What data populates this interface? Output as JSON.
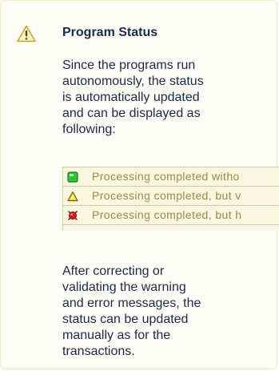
{
  "callout": {
    "type": "warning",
    "title": "Program Status",
    "intro": "Since the programs run autonomously, the status is automatically updated and can be displayed as following:",
    "outro": "After correcting or validating the warning and error messages, the status can be updated manually as for the transactions."
  },
  "status_table": {
    "rows": [
      {
        "icon": "green-square-status-icon",
        "label": "Processing completed witho"
      },
      {
        "icon": "yellow-triangle-warning-icon",
        "label": "Processing completed, but v"
      },
      {
        "icon": "red-error-status-icon",
        "label": "Processing completed, but h"
      }
    ]
  },
  "colors": {
    "callout_background": "#fffdf6",
    "callout_border": "#f1e7bf",
    "text": "#172b4d",
    "status_text": "#9a8a4a",
    "status_ok": "#2fc52f",
    "status_warning": "#f5d000",
    "status_error": "#e01a1a"
  }
}
